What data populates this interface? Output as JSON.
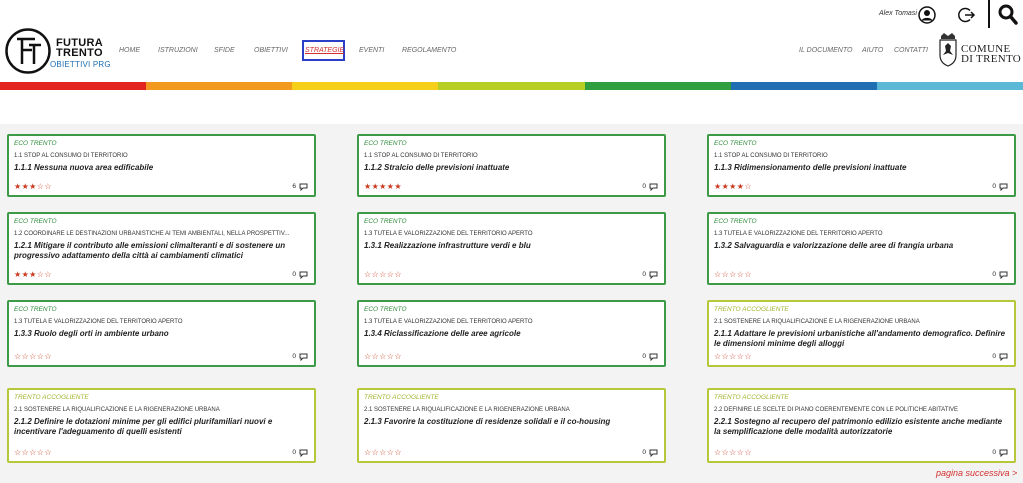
{
  "brand": {
    "line1": "FUTURA",
    "line2": "TRENTO",
    "subtitle": "OBIETTIVI PRG"
  },
  "nav": [
    {
      "label": "HOME"
    },
    {
      "label": "ISTRUZIONI"
    },
    {
      "label": "SFIDE"
    },
    {
      "label": "OBIETTIVI"
    },
    {
      "label": "STRATEGIE",
      "active": true
    },
    {
      "label": "EVENTI"
    },
    {
      "label": "REGOLAMENTO"
    }
  ],
  "nav_right": [
    {
      "label": "IL DOCUMENTO"
    },
    {
      "label": "AIUTO"
    },
    {
      "label": "CONTATTI"
    }
  ],
  "user": {
    "name": "Alex Tomasi"
  },
  "comune": {
    "line1": "COMUNE",
    "line2": "DI TRENTO"
  },
  "stripe_colors": [
    "#e3261f",
    "#f29a1f",
    "#f6cf1a",
    "#b7cf25",
    "#2e9e3f",
    "#1f6fb2",
    "#5bb8d6"
  ],
  "cards": [
    {
      "category": "ECO TRENTO",
      "type": "eco",
      "section": "1.1 STOP AL CONSUMO DI TERRITORIO",
      "title": "1.1.1 Nessuna nuova area edificabile",
      "rating": 3,
      "comments": "6"
    },
    {
      "category": "ECO TRENTO",
      "type": "eco",
      "section": "1.1 STOP AL CONSUMO DI TERRITORIO",
      "title": "1.1.2 Stralcio delle previsioni inattuate",
      "rating": 5,
      "comments": "0"
    },
    {
      "category": "ECO TRENTO",
      "type": "eco",
      "section": "1.1 STOP AL CONSUMO DI TERRITORIO",
      "title": "1.1.3 Ridimensionamento delle previsioni inattuate",
      "rating": 4,
      "comments": "0"
    },
    {
      "category": "ECO TRENTO",
      "type": "eco",
      "section": "1.2 COORDINARE LE DESTINAZIONI URBANISTICHE AI TEMI AMBIENTALI, NELLA PROSPETTIV...",
      "title": "1.2.1 Mitigare il contributo alle emissioni climalteranti e di sostenere un progressivo adattamento della città ai cambiamenti climatici",
      "rating": 3,
      "comments": "0"
    },
    {
      "category": "ECO TRENTO",
      "type": "eco",
      "section": "1.3 TUTELA E VALORIZZAZIONE DEL TERRITORIO APERTO",
      "title": "1.3.1 Realizzazione infrastrutture verdi e blu",
      "rating": 0,
      "comments": "0"
    },
    {
      "category": "ECO TRENTO",
      "type": "eco",
      "section": "1.3 TUTELA E VALORIZZAZIONE DEL TERRITORIO APERTO",
      "title": "1.3.2 Salvaguardia e valorizzazione delle aree di frangia urbana",
      "rating": 0,
      "comments": "0"
    },
    {
      "category": "ECO TRENTO",
      "type": "eco",
      "section": "1.3 TUTELA E VALORIZZAZIONE DEL TERRITORIO APERTO",
      "title": "1.3.3 Ruolo degli orti in ambiente urbano",
      "rating": 0,
      "comments": "0"
    },
    {
      "category": "ECO TRENTO",
      "type": "eco",
      "section": "1.3 TUTELA E VALORIZZAZIONE DEL TERRITORIO APERTO",
      "title": "1.3.4 Riclassificazione delle aree agricole",
      "rating": 0,
      "comments": "0"
    },
    {
      "category": "TRENTO ACCOGLIENTE",
      "type": "acc",
      "section": "2.1 SOSTENERE LA RIQUALIFICAZIONE E LA RIGENERAZIONE URBANA",
      "title": "2.1.1 Adattare le previsioni urbanistiche all'andamento demografico. Definire le dimensioni minime degli alloggi",
      "rating": 0,
      "comments": "0"
    },
    {
      "category": "TRENTO ACCOGLIENTE",
      "type": "acc",
      "section": "2.1 SOSTENERE LA RIQUALIFICAZIONE E LA RIGENERAZIONE URBANA",
      "title": "2.1.2 Definire le dotazioni minime per gli edifici plurifamiliari nuovi e incentivare l'adeguamento di quelli esistenti",
      "rating": 0,
      "comments": "0"
    },
    {
      "category": "TRENTO ACCOGLIENTE",
      "type": "acc",
      "section": "2.1 SOSTENERE LA RIQUALIFICAZIONE E LA RIGENERAZIONE URBANA",
      "title": "2.1.3 Favorire la costituzione di residenze solidali e il co-housing",
      "rating": 0,
      "comments": "0"
    },
    {
      "category": "TRENTO ACCOGLIENTE",
      "type": "acc",
      "section": "2.2 DEFINIRE LE SCELTE DI PIANO COERENTEMENTE CON LE POLITICHE ABITATIVE",
      "title": "2.2.1 Sostegno al recupero del patrimonio edilizio esistente anche mediante la semplificazione delle modalità autorizzatorie",
      "rating": 0,
      "comments": "0"
    }
  ],
  "pagination": {
    "next": "pagina successiva >"
  }
}
